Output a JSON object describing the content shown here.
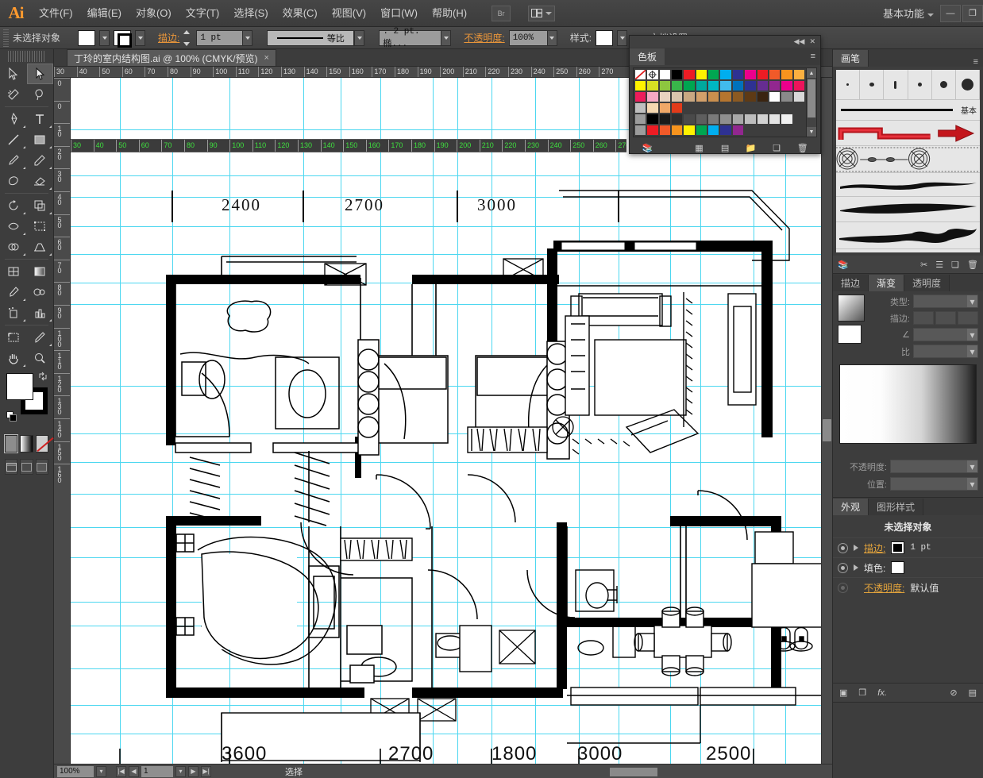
{
  "app": {
    "name": "Ai",
    "workspace": "基本功能"
  },
  "menubar": {
    "items": [
      "文件(F)",
      "编辑(E)",
      "对象(O)",
      "文字(T)",
      "选择(S)",
      "效果(C)",
      "视图(V)",
      "窗口(W)",
      "帮助(H)"
    ],
    "bridge_icon": "br-icon",
    "arrange_icon": "arrange-documents-icon",
    "minimize": "—",
    "restore": "❐"
  },
  "controlbar": {
    "selection_label": "未选择对象",
    "fill_swatch": "#ffffff",
    "stroke_swatch": "#ffffff",
    "stroke_label": "描边:",
    "stroke_weight": "1 pt",
    "stroke_profile": "等比",
    "brush_def": ". 2 pt. 椭...",
    "opacity_label": "不透明度:",
    "opacity_value": "100%",
    "style_label": "样式:",
    "doc_label": "文档设置"
  },
  "toolbar": {
    "tools": [
      {
        "name": "selection-tool",
        "active": false
      },
      {
        "name": "direct-selection-tool",
        "active": true
      },
      {
        "name": "magic-wand-tool",
        "active": false
      },
      {
        "name": "lasso-tool",
        "active": false
      },
      {
        "name": "pen-tool",
        "active": false
      },
      {
        "name": "type-tool",
        "active": false
      },
      {
        "name": "line-segment-tool",
        "active": false
      },
      {
        "name": "rectangle-tool",
        "active": false
      },
      {
        "name": "paintbrush-tool",
        "active": false
      },
      {
        "name": "pencil-tool",
        "active": false
      },
      {
        "name": "blob-brush-tool",
        "active": false
      },
      {
        "name": "eraser-tool",
        "active": false
      },
      {
        "name": "rotate-tool",
        "active": false
      },
      {
        "name": "scale-tool",
        "active": false
      },
      {
        "name": "width-tool",
        "active": false
      },
      {
        "name": "free-transform-tool",
        "active": false
      },
      {
        "name": "shape-builder-tool",
        "active": false
      },
      {
        "name": "perspective-grid-tool",
        "active": false
      },
      {
        "name": "mesh-tool",
        "active": false
      },
      {
        "name": "gradient-tool",
        "active": false
      },
      {
        "name": "eyedropper-tool",
        "active": false
      },
      {
        "name": "blend-tool",
        "active": false
      },
      {
        "name": "symbol-sprayer-tool",
        "active": false
      },
      {
        "name": "column-graph-tool",
        "active": false
      },
      {
        "name": "artboard-tool",
        "active": false
      },
      {
        "name": "slice-tool",
        "active": false
      },
      {
        "name": "hand-tool",
        "active": false
      },
      {
        "name": "zoom-tool",
        "active": false
      }
    ],
    "fill_color": "#ffffff",
    "stroke_color": "#000000",
    "mode_color": "#ffffff",
    "mode_gradient": "gradient",
    "mode_none": "none"
  },
  "document": {
    "tab_title": "丁玲的室内结构图.ai @ 100% (CMYK/预览)",
    "close_glyph": "×",
    "ruler_h_ticks": [
      "30",
      "40",
      "50",
      "60",
      "70",
      "80",
      "90",
      "100",
      "110",
      "120",
      "130",
      "140",
      "150",
      "160",
      "170",
      "180",
      "190",
      "200",
      "210",
      "220",
      "230",
      "240",
      "250",
      "260",
      "270"
    ],
    "ruler_green_ticks": [
      "30",
      "40",
      "50",
      "60",
      "70",
      "80",
      "90",
      "100",
      "110",
      "120",
      "130",
      "140",
      "150",
      "160",
      "170",
      "180",
      "190",
      "200",
      "210",
      "220",
      "230",
      "240",
      "250",
      "260",
      "270"
    ],
    "ruler_v_ticks": [
      "0",
      "0",
      "10",
      "20",
      "30",
      "40",
      "50",
      "60",
      "70",
      "80",
      "90",
      "100",
      "110",
      "120",
      "130",
      "140",
      "150",
      "160"
    ]
  },
  "plan": {
    "top_dimensions": [
      "2400",
      "2700",
      "3000"
    ],
    "bottom_dimensions": [
      "3600",
      "2700",
      "1800",
      "3000",
      "2500"
    ],
    "guide_color": "#4cd7f0"
  },
  "statusbar": {
    "zoom": "100%",
    "page": "1",
    "status_text": "选择",
    "first_glyph": "|◀",
    "prev_glyph": "◀",
    "next_glyph": "▶",
    "last_glyph": "▶|"
  },
  "panels": {
    "brushes": {
      "tab": "画笔",
      "menu_glyph": "≡"
    },
    "gradient": {
      "tabs": [
        "描边",
        "渐变",
        "透明度"
      ],
      "active_tab": "渐变",
      "type_label": "类型:",
      "stroke_label": "描边:",
      "angle_label": "∠",
      "ratio_label": "比",
      "opacity_label": "不透明度:",
      "location_label": "位置:"
    },
    "appearance": {
      "tabs": [
        "外观",
        "图形样式"
      ],
      "active_tab": "外观",
      "title": "未选择对象",
      "rows": [
        {
          "label": "描边:",
          "value": "1 pt",
          "orange": true,
          "swatch": "black"
        },
        {
          "label": "填色:",
          "value": "",
          "orange": false,
          "swatch": "white"
        },
        {
          "label": "不透明度:",
          "value": "默认值",
          "orange": true,
          "swatch": "none"
        }
      ],
      "footer_icons": [
        "new-art-icon",
        "duplicate-icon",
        "fx-icon",
        "clear-icon",
        "delete-icon"
      ]
    },
    "swatches": {
      "tab": "色板",
      "menu_glyph": "≡",
      "collapse_glyph": "◀◀",
      "close_glyph": "✕",
      "footer_icons": [
        "swatch-libraries-icon",
        "show-kinds-icon",
        "swatch-options-icon",
        "new-group-icon",
        "new-swatch-icon",
        "delete-swatch-icon"
      ],
      "colors": [
        "none",
        "registration",
        "#ffffff",
        "#000000",
        "#ed1c24",
        "#fff200",
        "#00a651",
        "#00aeef",
        "#2e3192",
        "#ec008c",
        "#ed1c24",
        "#f15a29",
        "#f7941e",
        "#fbb040",
        "#fff200",
        "#d7df23",
        "#8dc63f",
        "#39b54a",
        "#00a651",
        "#00a99d",
        "#00b7c3",
        "#41bbec",
        "#0072bc",
        "#2e3192",
        "#662d91",
        "#92278f",
        "#ec008c",
        "#ed145b",
        "#ed1c5b",
        "#f7a8c4",
        "#e8d3c0",
        "#d9c5ae",
        "#c9a882",
        "#d3a06a",
        "#c98f4e",
        "#b5752f",
        "#8c5a22",
        "#5e3a15",
        "#3a2410",
        "#ffffff",
        "#8a8a8a",
        "#d9d9d9",
        "#bfbfbf",
        "#f5d7b0",
        "#f0a868",
        "#e23b1a",
        "#3d3d3d",
        "#3d3d3d",
        "#3d3d3d",
        "#3d3d3d",
        "#3d3d3d",
        "#3d3d3d",
        "#3d3d3d",
        "#3d3d3d",
        "#3d3d3d",
        "#3d3d3d",
        "#9c9c9c",
        "#000000",
        "#1a1a1a",
        "#2e2e2e",
        "#4a4a4a",
        "#5e5e5e",
        "#7a7a7a",
        "#8f8f8f",
        "#a8a8a8",
        "#bdbdbd",
        "#d2d2d2",
        "#e3e3e3",
        "#f0f0f0",
        "#3d3d3d",
        "#9c9c9c",
        "#ed1c24",
        "#f15a29",
        "#f7941e",
        "#fff200",
        "#00a651",
        "#00aeef",
        "#2e3192",
        "#92278f",
        "#3d3d3d",
        "#3d3d3d",
        "#3d3d3d",
        "#3d3d3d",
        "#3d3d3d"
      ]
    }
  }
}
